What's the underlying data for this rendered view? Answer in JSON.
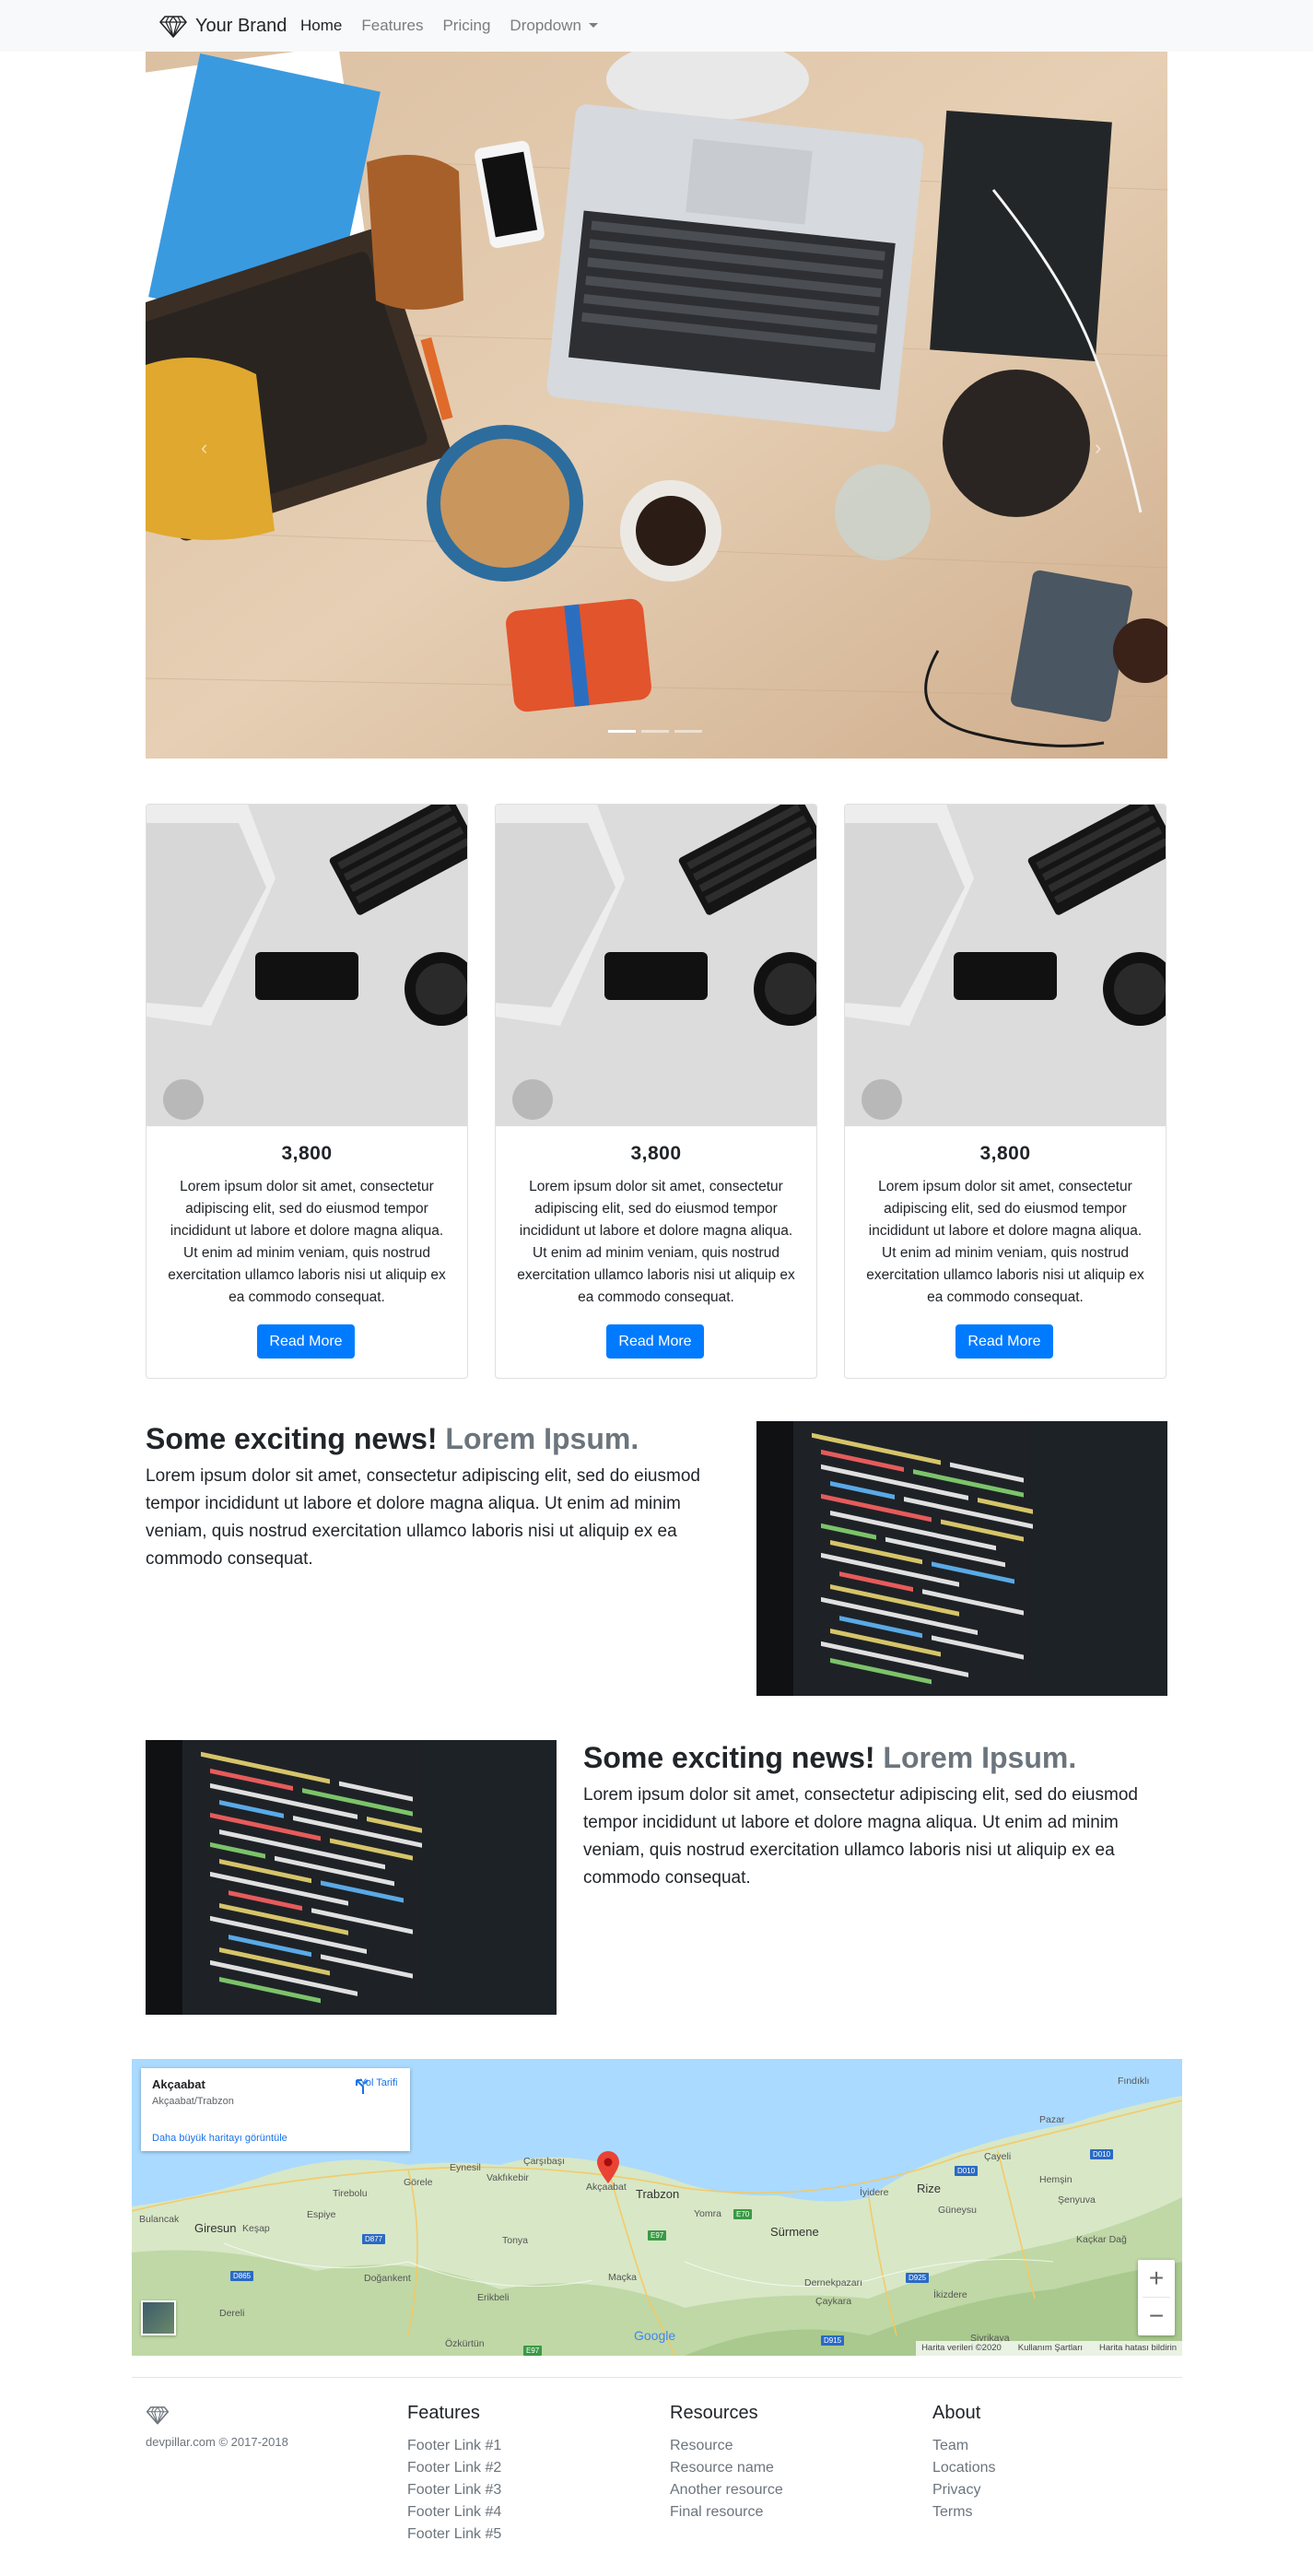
{
  "navbar": {
    "brand": "Your Brand",
    "brand_icon": "diamond-icon",
    "links": [
      {
        "label": "Home",
        "active": true
      },
      {
        "label": "Features",
        "active": false
      },
      {
        "label": "Pricing",
        "active": false
      },
      {
        "label": "Dropdown",
        "active": false,
        "dropdown": true
      }
    ]
  },
  "carousel": {
    "image": "desk-flatlay-laptop-notebooks-photo",
    "slide_count": 3,
    "active_slide": 1
  },
  "cards": [
    {
      "image": "developer-desk-keyboard-photo",
      "title": "3,800",
      "text": "Lorem ipsum dolor sit amet, consectetur adipiscing elit, sed do eiusmod tempor incididunt ut labore et dolore magna aliqua. Ut enim ad minim veniam, quis nostrud exercitation ullamco laboris nisi ut aliquip ex ea commodo consequat.",
      "button": "Read More"
    },
    {
      "image": "developer-desk-keyboard-photo",
      "title": "3,800",
      "text": "Lorem ipsum dolor sit amet, consectetur adipiscing elit, sed do eiusmod tempor incididunt ut labore et dolore magna aliqua. Ut enim ad minim veniam, quis nostrud exercitation ullamco laboris nisi ut aliquip ex ea commodo consequat.",
      "button": "Read More"
    },
    {
      "image": "developer-desk-keyboard-photo",
      "title": "3,800",
      "text": "Lorem ipsum dolor sit amet, consectetur adipiscing elit, sed do eiusmod tempor incididunt ut labore et dolore magna aliqua. Ut enim ad minim veniam, quis nostrud exercitation ullamco laboris nisi ut aliquip ex ea commodo consequat.",
      "button": "Read More"
    }
  ],
  "featurettes": [
    {
      "heading": "Some exciting news!",
      "heading_muted": "Lorem Ipsum.",
      "text": "Lorem ipsum dolor sit amet, consectetur adipiscing elit, sed do eiusmod tempor incididunt ut labore et dolore magna aliqua. Ut enim ad minim veniam, quis nostrud exercitation ullamco laboris nisi ut aliquip ex ea commodo consequat.",
      "image": "code-editor-screen-photo"
    },
    {
      "heading": "Some exciting news!",
      "heading_muted": "Lorem Ipsum.",
      "text": "Lorem ipsum dolor sit amet, consectetur adipiscing elit, sed do eiusmod tempor incididunt ut labore et dolore magna aliqua. Ut enim ad minim veniam, quis nostrud exercitation ullamco laboris nisi ut aliquip ex ea commodo consequat.",
      "image": "code-editor-screen-photo"
    }
  ],
  "map": {
    "place_name": "Akçaabat",
    "place_address": "Akçaabat/Trabzon",
    "larger_map_link": "Daha büyük haritayı görüntüle",
    "directions_label": "Yol Tarifi",
    "zoom_in": "+",
    "zoom_out": "−",
    "google": "Google",
    "attribution": [
      "Harita verileri ©2020",
      "Kullanım Şartları",
      "Harita hatası bildirin"
    ],
    "labels": {
      "findikli": "Fındıklı",
      "pazar": "Pazar",
      "cayeli": "Çayeli",
      "hemsin": "Hemşin",
      "senyuva": "Şenyuva",
      "kackar": "Kaçkar Dağ",
      "rize": "Rize",
      "iyidere": "İyidere",
      "guneysu": "Güneysu",
      "carsibasi": "Çarşıbaşı",
      "eynesil": "Eynesil",
      "vakfikebir": "Vakfıkebir",
      "gorele": "Görele",
      "tirebolu": "Tirebolu",
      "akcaabat": "Akçaabat",
      "trabzon": "Trabzon",
      "yomra": "Yomra",
      "surmene": "Sürmene",
      "bulancak": "Bulancak",
      "giresun": "Giresun",
      "kesap": "Keşap",
      "espiye": "Espiye",
      "tonya": "Tonya",
      "dogankent": "Doğankent",
      "macka": "Maçka",
      "erikbeli": "Erikbeli",
      "dernekpazari": "Dernekpazarı",
      "caykara": "Çaykara",
      "ikizdere": "İkizdere",
      "dereli": "Dereli",
      "ozkurtun": "Özkürtün",
      "surmenetipi": "Sivrikaya"
    },
    "roads": {
      "d010": "D010",
      "d010b": "D010",
      "d877": "D877",
      "d865": "D865",
      "d925": "D925",
      "d915": "D915",
      "e70": "E70",
      "e97": "E97",
      "e97b": "E97"
    },
    "pin_color": "#ea4335"
  },
  "footer": {
    "logo_icon": "diamond-icon",
    "copyright": "devpillar.com © 2017-2018",
    "columns": [
      {
        "title": "Features",
        "links": [
          "Footer Link #1",
          "Footer Link #2",
          "Footer Link #3",
          "Footer Link #4",
          "Footer Link #5"
        ]
      },
      {
        "title": "Resources",
        "links": [
          "Resource",
          "Resource name",
          "Another resource",
          "Final resource"
        ]
      },
      {
        "title": "About",
        "links": [
          "Team",
          "Locations",
          "Privacy",
          "Terms"
        ]
      }
    ]
  },
  "colors": {
    "primary": "#007bff",
    "muted": "#6c757d",
    "navbar_bg": "#f8f9fa"
  }
}
